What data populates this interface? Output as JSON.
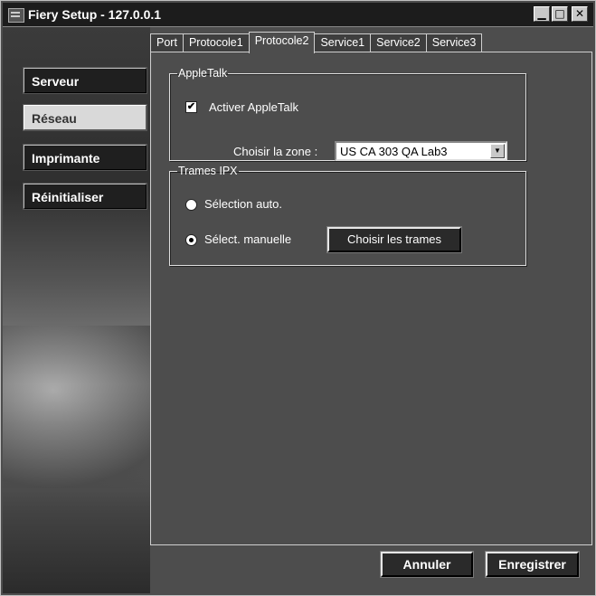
{
  "window": {
    "title": "Fiery Setup - 127.0.0.1"
  },
  "titlebar_buttons": {
    "minimize": "▁",
    "maximize": "□",
    "close": "✕"
  },
  "sidebar": {
    "items": [
      {
        "label": "Serveur"
      },
      {
        "label": "Réseau"
      },
      {
        "label": "Imprimante"
      },
      {
        "label": "Réinitialiser"
      }
    ],
    "selected": "Réseau"
  },
  "tabs": [
    {
      "label": "Port"
    },
    {
      "label": "Protocole1"
    },
    {
      "label": "Protocole2"
    },
    {
      "label": "Service1"
    },
    {
      "label": "Service2"
    },
    {
      "label": "Service3"
    }
  ],
  "active_tab": "Protocole2",
  "appletalk": {
    "legend": "AppleTalk",
    "enable_label": "Activer AppleTalk",
    "enabled": true,
    "zone_label": "Choisir la zone :",
    "zone_value": "US CA 303 QA Lab3"
  },
  "ipx": {
    "legend": "Trames IPX",
    "auto_label": "Sélection auto.",
    "manual_label": "Sélect. manuelle",
    "selected": "manual",
    "choose_button": "Choisir les trames"
  },
  "footer": {
    "cancel_label": "Annuler",
    "save_label": "Enregistrer"
  }
}
